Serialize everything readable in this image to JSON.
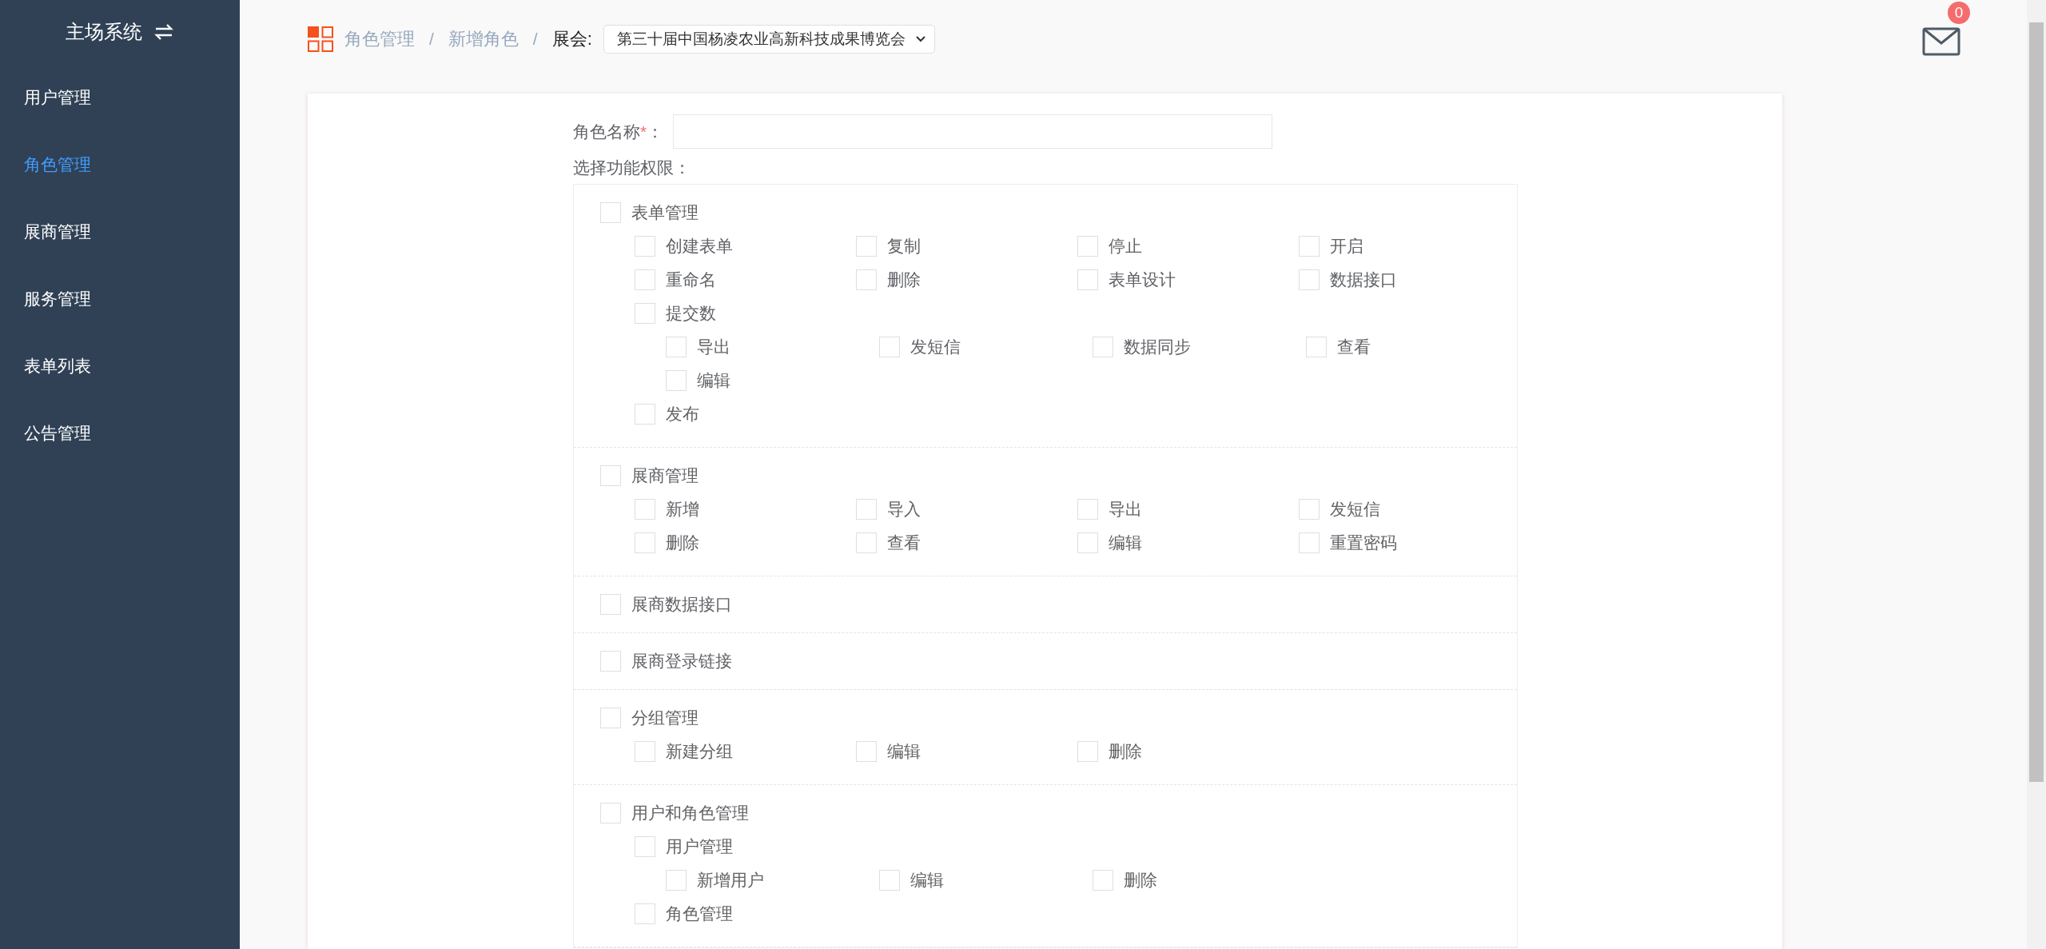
{
  "sidebar": {
    "title": "主场系统",
    "items": [
      {
        "label": "用户管理",
        "selected": false
      },
      {
        "label": "角色管理",
        "selected": true
      },
      {
        "label": "展商管理",
        "selected": false
      },
      {
        "label": "服务管理",
        "selected": false
      },
      {
        "label": "表单列表",
        "selected": false
      },
      {
        "label": "公告管理",
        "selected": false
      }
    ]
  },
  "breadcrumb": {
    "parts": [
      {
        "kind": "link",
        "text": "角色管理"
      },
      {
        "kind": "separator",
        "text": "/"
      },
      {
        "kind": "link",
        "text": "新增角色"
      },
      {
        "kind": "separator",
        "text": "/"
      }
    ],
    "expo_label": "展会:",
    "expo_value": "第三十届中国杨凌农业高新科技成果博览会"
  },
  "mail": {
    "badge": "0"
  },
  "form": {
    "name_label": "角色名称",
    "required_mark": "*",
    "name_suffix": "：",
    "permissions_label": "选择功能权限：",
    "sections": [
      {
        "label": "表单管理",
        "checked": false,
        "children": [
          {
            "label": "创建表单",
            "checked": false
          },
          {
            "label": "复制",
            "checked": false
          },
          {
            "label": "停止",
            "checked": false
          },
          {
            "label": "开启",
            "checked": false
          },
          {
            "label": "重命名",
            "checked": false
          },
          {
            "label": "删除",
            "checked": false
          },
          {
            "label": "表单设计",
            "checked": false
          },
          {
            "label": "数据接口",
            "checked": false
          },
          {
            "label": "提交数",
            "checked": false,
            "children": [
              {
                "label": "导出",
                "checked": false
              },
              {
                "label": "发短信",
                "checked": false
              },
              {
                "label": "数据同步",
                "checked": false
              },
              {
                "label": "查看",
                "checked": false
              },
              {
                "label": "编辑",
                "checked": false
              }
            ]
          },
          {
            "label": "发布",
            "checked": false
          }
        ]
      },
      {
        "label": "展商管理",
        "checked": false,
        "children": [
          {
            "label": "新增",
            "checked": false
          },
          {
            "label": "导入",
            "checked": false
          },
          {
            "label": "导出",
            "checked": false
          },
          {
            "label": "发短信",
            "checked": false
          },
          {
            "label": "删除",
            "checked": false
          },
          {
            "label": "查看",
            "checked": false
          },
          {
            "label": "编辑",
            "checked": false
          },
          {
            "label": "重置密码",
            "checked": false
          }
        ]
      },
      {
        "label": "展商数据接口",
        "checked": false
      },
      {
        "label": "展商登录链接",
        "checked": false
      },
      {
        "label": "分组管理",
        "checked": false,
        "children": [
          {
            "label": "新建分组",
            "checked": false
          },
          {
            "label": "编辑",
            "checked": false
          },
          {
            "label": "删除",
            "checked": false
          }
        ]
      },
      {
        "label": "用户和角色管理",
        "checked": false,
        "children": [
          {
            "label": "用户管理",
            "checked": false,
            "children": [
              {
                "label": "新增用户",
                "checked": false
              },
              {
                "label": "编辑",
                "checked": false
              },
              {
                "label": "删除",
                "checked": false
              }
            ]
          },
          {
            "label": "角色管理",
            "checked": false
          }
        ]
      }
    ]
  }
}
